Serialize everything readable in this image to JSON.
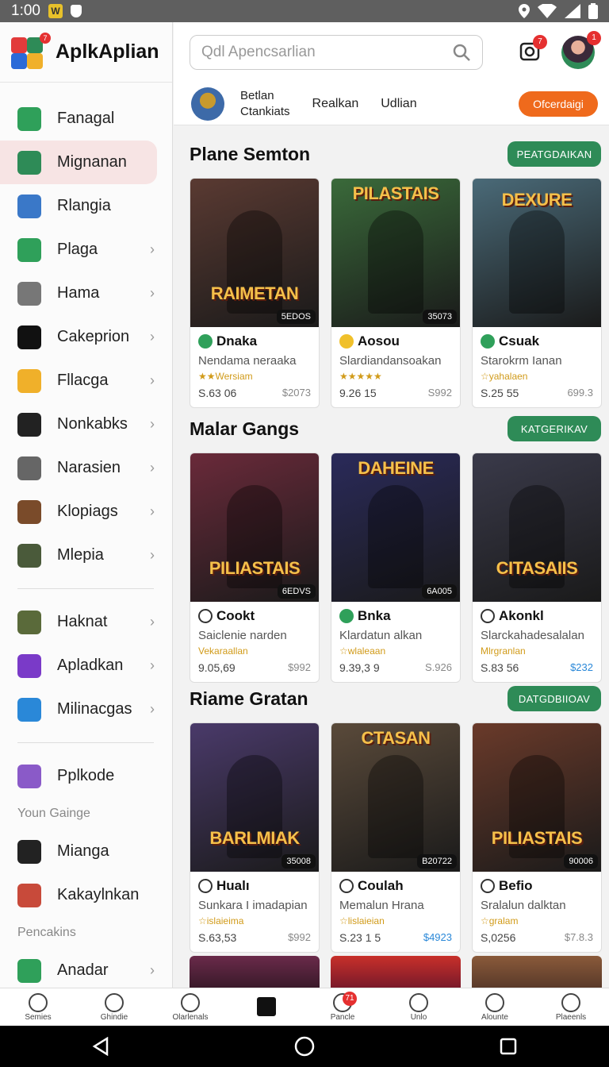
{
  "status_bar": {
    "time": "1:00"
  },
  "app": {
    "name": "AplkAplian"
  },
  "search": {
    "placeholder": "Qdl Apencsarlian"
  },
  "top_badges": {
    "notifications": "7",
    "profile": "1"
  },
  "subbar": {
    "line1": "Betlan",
    "line2": "Ctankiats",
    "link1": "Realkan",
    "link2": "Udlian",
    "button": "Ofcerdaigi"
  },
  "sidebar": {
    "items": [
      {
        "label": "Fanagal",
        "icon": "close-circle-icon",
        "color": "#2fa05a",
        "chev": false
      },
      {
        "label": "Mignanan",
        "icon": "puzzle-icon",
        "color": "#2e8b57",
        "chev": false,
        "active": true
      },
      {
        "label": "Rlangia",
        "icon": "panel-icon",
        "color": "#3a78c8",
        "chev": false
      },
      {
        "label": "Plaga",
        "icon": "check-circle-icon",
        "color": "#2fa05a",
        "chev": true
      },
      {
        "label": "Hama",
        "icon": "list-icon",
        "color": "#777",
        "chev": true
      },
      {
        "label": "Cakeprion",
        "icon": "console-icon",
        "color": "#111",
        "chev": true
      },
      {
        "label": "Fllacga",
        "icon": "runner-icon",
        "color": "#f0b02a",
        "chev": true
      },
      {
        "label": "Nonkabks",
        "icon": "dice-icon",
        "color": "#222",
        "chev": true
      },
      {
        "label": "Narasien",
        "icon": "number-icon",
        "color": "#666",
        "chev": true
      },
      {
        "label": "Klopiags",
        "icon": "warrior-icon",
        "color": "#7a4b2a",
        "chev": true
      },
      {
        "label": "Mlepia",
        "icon": "hero-icon",
        "color": "#4a5a3a",
        "chev": true
      }
    ],
    "items2": [
      {
        "label": "Haknat",
        "icon": "soldier-icon",
        "color": "#5a6a3a",
        "chev": true
      },
      {
        "label": "Apladkan",
        "icon": "lock-icon",
        "color": "#7a3ac8",
        "chev": true
      },
      {
        "label": "Milinacgas",
        "icon": "gamer-icon",
        "color": "#2a88d8",
        "chev": true
      }
    ],
    "items3": [
      {
        "label": "Pplkode",
        "icon": "planet-icon",
        "color": "#8a5ac8",
        "chev": false
      }
    ],
    "section1": "Youn Gainge",
    "items4": [
      {
        "label": "Mianga",
        "icon": "chat-icon",
        "color": "#222",
        "chev": false
      },
      {
        "label": "Kakaylnkan",
        "icon": "robot-icon",
        "color": "#c84a3a",
        "chev": false
      }
    ],
    "section2": "Pencakins",
    "items5": [
      {
        "label": "Anadar",
        "icon": "player-icon",
        "color": "#2fa05a",
        "chev": true
      }
    ]
  },
  "sections": [
    {
      "title": "Plane Semton",
      "button": "PEATGDAIKAN",
      "cards": [
        {
          "art": "RAIMETAN",
          "tag": "5EDOS",
          "name": "Dnaka",
          "icon": "leaf-icon",
          "desc": "Nendama neraaka",
          "rating": "★★Wersiam",
          "price": "S.63 06",
          "price2": "$2073",
          "blue": false,
          "bg": "#5a3a32"
        },
        {
          "art": "PILASTAIS",
          "tag": "35073",
          "name": "Aosou",
          "icon": "star-icon",
          "desc": "Slardiandansoakan",
          "rating": "★★★★★",
          "price": "9.26 15",
          "price2": "S992",
          "blue": false,
          "bg": "#3a6a3a"
        },
        {
          "art": "DEXURE",
          "tag": "",
          "name": "Csuak",
          "icon": "leaf-icon",
          "desc": "Starokrm Ianan",
          "rating": "☆yahalaen",
          "price": "S.25 55",
          "price2": "699.3",
          "blue": false,
          "bg": "#4a6a78"
        }
      ]
    },
    {
      "title": "Malar Gangs",
      "button": "KATGERIKAV",
      "cards": [
        {
          "art": "PILIASTAIS",
          "tag": "6EDVS",
          "name": "Cookt",
          "icon": "gear-icon",
          "desc": "Saiclenie narden",
          "rating": "Vekaraallan",
          "price": "9.05,69",
          "price2": "$992",
          "blue": false,
          "bg": "#6a2a3a"
        },
        {
          "art": "DAHEINE",
          "tag": "6A005",
          "name": "Bnka",
          "icon": "leaf-icon",
          "desc": "Klardatun alkan",
          "rating": "☆wlaleaan",
          "price": "9.39,3 9",
          "price2": "S.926",
          "blue": false,
          "bg": "#2a2a5a"
        },
        {
          "art": "CITASAIIS",
          "tag": "",
          "name": "Akonkl",
          "icon": "star-outline-icon",
          "desc": "Slarckahadesalalan",
          "rating": "Mlrgranlan",
          "price": "S.83 56",
          "price2": "$232",
          "blue": true,
          "bg": "#3a3a4a"
        }
      ]
    },
    {
      "title": "Riame Gratan",
      "button": "DATGDBIIOAV",
      "cards": [
        {
          "art": "BARLMIAK",
          "tag": "35008",
          "name": "Hualı",
          "icon": "star-outline-icon",
          "desc": "Sunkara I imadapian",
          "rating": "☆islaieima",
          "price": "S.63,53",
          "price2": "$992",
          "blue": false,
          "bg": "#4a3a6a"
        },
        {
          "art": "CTASAN",
          "tag": "B20722",
          "name": "Coulah",
          "icon": "gear-icon",
          "desc": "Memalun Hrana",
          "rating": "☆lislaieian",
          "price": "S.23 1 5",
          "price2": "$4923",
          "blue": true,
          "bg": "#5a4a3a"
        },
        {
          "art": "PILIASTAIS",
          "tag": "90006",
          "name": "Befio",
          "icon": "shield-icon",
          "desc": "Sralalun dalktan",
          "rating": "☆gralam",
          "price": "S,0256",
          "price2": "$7.8.3",
          "blue": false,
          "bg": "#6a3a2a"
        }
      ]
    }
  ],
  "bottom_nav": [
    {
      "label": "Semies",
      "icon": "home-icon"
    },
    {
      "label": "Ghindie",
      "icon": "g-icon"
    },
    {
      "label": "Olarlenals",
      "icon": "refresh-icon"
    },
    {
      "label": "",
      "icon": "list-box-icon"
    },
    {
      "label": "Pancle",
      "icon": "bell-icon",
      "badge": "71"
    },
    {
      "label": "Unlo",
      "icon": "image-icon"
    },
    {
      "label": "Alounte",
      "icon": "search-icon"
    },
    {
      "label": "Plaeenls",
      "icon": "person-icon"
    }
  ]
}
